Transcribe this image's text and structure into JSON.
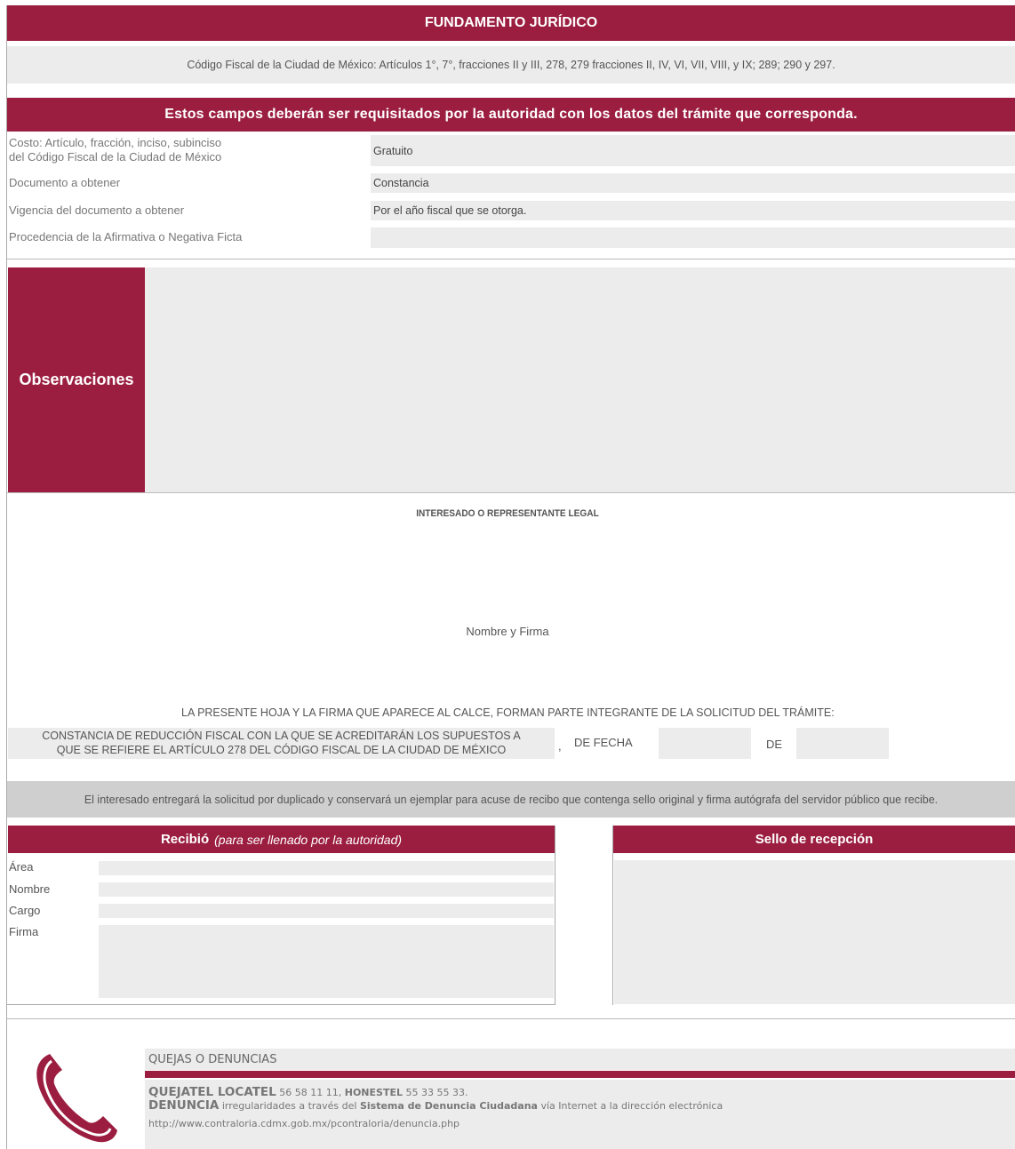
{
  "fundamento": {
    "title": "FUNDAMENTO JURÍDICO",
    "text": "Código Fiscal de la Ciudad de México: Artículos 1°, 7°, fracciones II y III, 278, 279 fracciones II, IV, VI, VII, VIII, y IX; 289; 290 y 297."
  },
  "requisitos": {
    "title": "Estos campos deberán ser requisitados por la autoridad con los datos del trámite que corresponda.",
    "rows": [
      {
        "label_line1": "Costo: Artículo, fracción, inciso, subinciso",
        "label_line2": "del Código Fiscal de la Ciudad de México",
        "value": "Gratuito"
      },
      {
        "label": "Documento a obtener",
        "value": "Constancia"
      },
      {
        "label": "Vigencia del documento a obtener",
        "value": "Por el año fiscal que se otorga."
      },
      {
        "label": "Procedencia de la Afirmativa o Negativa Ficta",
        "value": ""
      }
    ]
  },
  "observaciones": {
    "label": "Observaciones"
  },
  "firma": {
    "title": "INTERESADO O REPRESENTANTE LEGAL",
    "nombre_firma": "Nombre y Firma",
    "presente": "LA PRESENTE HOJA Y LA FIRMA QUE APARECE AL CALCE, FORMAN PARTE INTEGRANTE DE LA SOLICITUD DEL TRÁMITE:",
    "tramite_line1": "CONSTANCIA DE REDUCCIÓN FISCAL CON LA QUE SE ACREDITARÁN LOS SUPUESTOS A",
    "tramite_line2": "QUE SE REFIERE EL ARTÍCULO 278 DEL CÓDIGO FISCAL DE LA CIUDAD DE MÉXICO",
    "comma": ",",
    "de_fecha": "DE FECHA",
    "de": "DE"
  },
  "aviso": "El interesado entregará la solicitud por duplicado y conservará un ejemplar para acuse de recibo que contenga sello original y firma autógrafa del servidor público que recibe.",
  "recibio": {
    "title": "Recibió",
    "subtitle": "(para ser llenado por la autoridad)",
    "fields": [
      "Área",
      "Nombre",
      "Cargo",
      "Firma"
    ]
  },
  "sello": {
    "title": "Sello de recepción"
  },
  "quejas": {
    "title": "QUEJAS O DENUNCIAS",
    "quejatel": "QUEJATEL LOCATEL",
    "quejatel_num": "56 58 11 11,",
    "honestel": "HONESTEL",
    "honestel_num": "55 33 55 33.",
    "denuncia": "DENUNCIA",
    "denuncia_text1": "irregularidades a través del",
    "sistema": "Sistema de Denuncia Ciudadana",
    "denuncia_text2": "vía Internet a la dirección electrónica",
    "url": "http://www.contraloria.cdmx.gob.mx/pcontraloria/denuncia.php"
  },
  "colors": {
    "maroon": "#9b1e40",
    "field_grey": "#ececec",
    "band_grey": "#cfcfcf"
  }
}
